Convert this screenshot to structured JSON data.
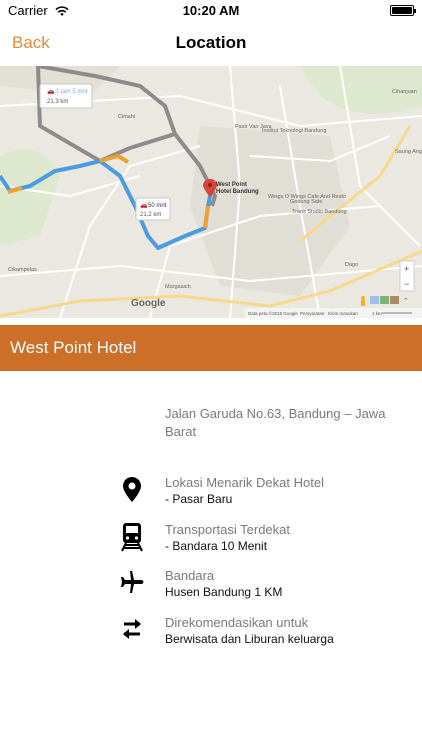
{
  "status_bar": {
    "carrier": "Carrier",
    "time": "10:20 AM"
  },
  "nav": {
    "back_label": "Back",
    "title": "Location"
  },
  "map": {
    "google_label": "Google",
    "route1_time": "1 jam 5 mnt",
    "route1_distance": "21,3 km",
    "route2_time": "50 mnt",
    "route2_distance": "21,2 km",
    "marker_label_line1": "West Point",
    "marker_label_line2": "Hotel Bandung",
    "places": [
      "Pasir Van Java",
      "Institut Teknologi Bandung",
      "Gedung Sate",
      "Saung Ang",
      "Cihanjuan",
      "Wings O Wings Cafe And Resto",
      "Trans Studio Bandung",
      "Cimahi",
      "Margaasih",
      "Cikampelas",
      "Dago"
    ],
    "attribution": "Data peta ©2016 Google",
    "terms": "Persyaratan",
    "report": "Kirim masukan",
    "scale": "1 km",
    "colors": {
      "route_main": "#4a9be0",
      "route_alt": "#8c8c8c",
      "traffic": "#f0a030"
    }
  },
  "hotel": {
    "name": "West Point Hotel"
  },
  "address": "Jalan Garuda No.63, Bandung – Jawa Barat",
  "info": [
    {
      "icon": "location-pin-icon",
      "label": "Lokasi Menarik Dekat Hotel",
      "value": "- Pasar Baru"
    },
    {
      "icon": "train-icon",
      "label": "Transportasi Terdekat",
      "value": "- Bandara 10 Menit"
    },
    {
      "icon": "airplane-icon",
      "label": "Bandara",
      "value": "Husen Bandung 1 KM"
    },
    {
      "icon": "swap-arrows-icon",
      "label": "Direkomendasikan untuk",
      "value": "Berwisata dan Liburan keluarga"
    }
  ],
  "colors": {
    "accent": "#e38a3d",
    "hotel_bar": "#cc6f29"
  }
}
